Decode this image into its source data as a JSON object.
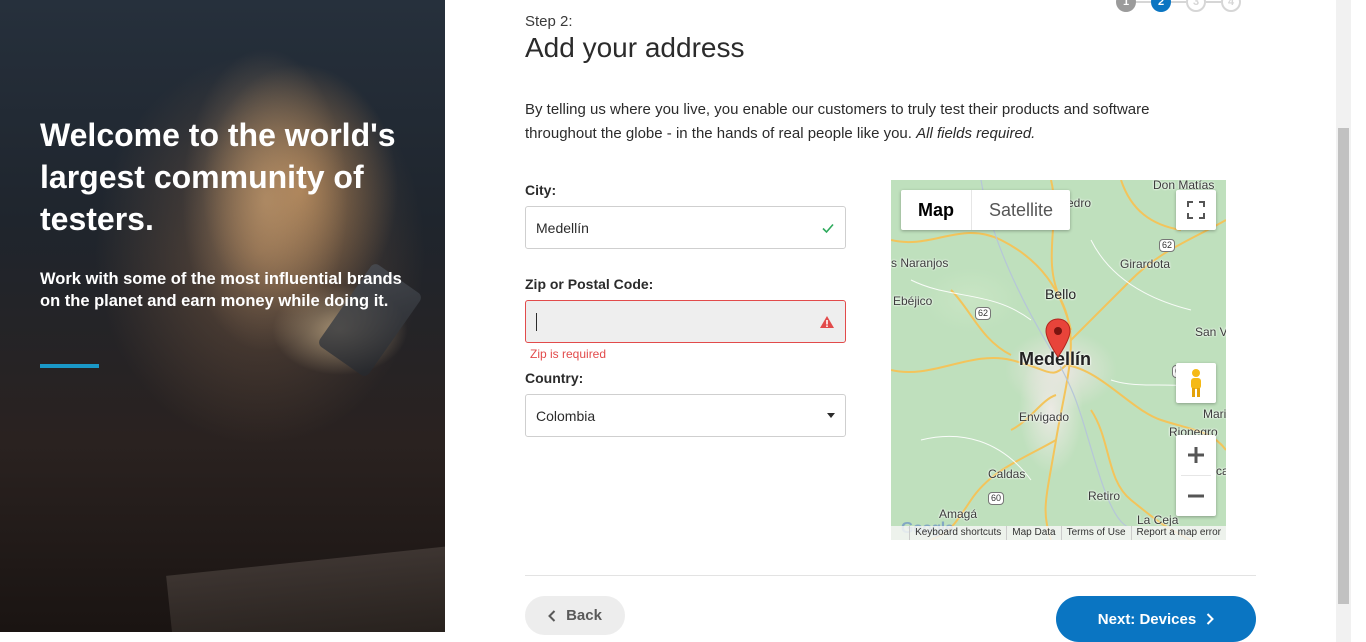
{
  "hero": {
    "title": "Welcome to the world's largest community of testers.",
    "subtitle": "Work with some of the most influential brands on the planet and earn money while doing it.",
    "accent_color": "#1a98c7"
  },
  "stepper": {
    "steps": [
      "1",
      "2",
      "3",
      "4"
    ],
    "current": 2
  },
  "step_label": "Step 2:",
  "title": "Add your address",
  "intro": {
    "text": "By telling us where you live, you enable our customers to truly test their products and software throughout the globe - in the hands of real people like you.",
    "emphasis": "All fields required."
  },
  "form": {
    "city": {
      "label": "City:",
      "value": "Medellín",
      "status": "valid"
    },
    "zip": {
      "label": "Zip or Postal Code:",
      "value": "",
      "status": "error",
      "error": "Zip is required"
    },
    "country": {
      "label": "Country:",
      "value": "Colombia"
    }
  },
  "map": {
    "type_options": [
      "Map",
      "Satellite"
    ],
    "selected_type": "Map",
    "places": {
      "don_matias": "Don Matías",
      "edro": "edro",
      "naranjos": "s Naranjos",
      "girardota": "Girardota",
      "bello": "Bello",
      "ebejico": "Ebéjico",
      "san_v": "San V",
      "medellin": "Medellín",
      "envigado": "Envigado",
      "mari": "Mari",
      "rionegro": "Rionegro",
      "caldas": "Caldas",
      "retiro": "Retiro",
      "amaga": "Amagá",
      "la_ceja": "La Ceja",
      "ca": "ca"
    },
    "shields": [
      "62",
      "62",
      "60",
      "60",
      "62"
    ],
    "footer": [
      "Keyboard shortcuts",
      "Map Data",
      "Terms of Use",
      "Report a map error"
    ],
    "logo": "Google"
  },
  "buttons": {
    "back": "Back",
    "next": "Next: Devices"
  },
  "colors": {
    "primary": "#0a75c2",
    "error": "#e24b4b",
    "valid": "#2eaa5c"
  }
}
